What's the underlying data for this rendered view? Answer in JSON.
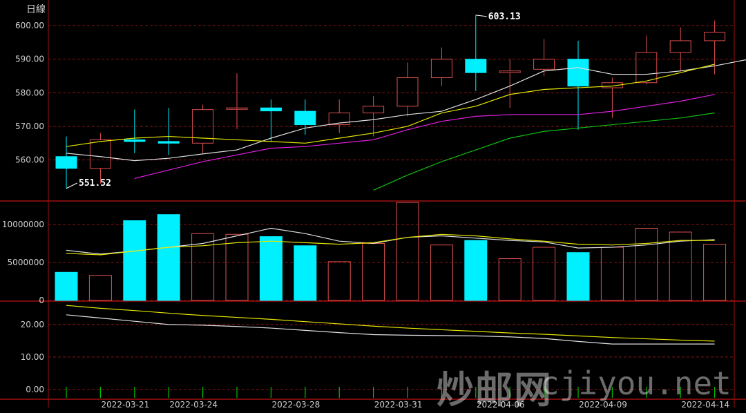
{
  "title": "日線",
  "watermark": {
    "chinese": "炒邮网",
    "latin": "cjiyou.net"
  },
  "colors": {
    "background": "#000000",
    "frame": "#a01010",
    "grid": "#8a1414",
    "up": "#e05050",
    "down": "#00f0ff",
    "text": "#d0d0d0",
    "ma_white": "#e0e0e0",
    "ma_yellow": "#e6e600",
    "ma_magenta": "#e020e0",
    "ma_green": "#10c010",
    "tick_green": "#00c000"
  },
  "chart_data": [
    {
      "type": "candlestick",
      "y_ticks": [
        "560.00",
        "570.00",
        "580.00",
        "590.00",
        "600.00"
      ],
      "ylim": [
        548,
        607
      ],
      "x_dates": [
        "2022-03-21",
        "2022-03-24",
        "2022-03-28",
        "2022-03-31",
        "2022-04-06",
        "2022-04-09",
        "2022-04-14"
      ],
      "x_date_index": [
        1,
        3,
        6,
        9,
        12,
        15,
        18
      ],
      "high_annotation": {
        "label": "603.13",
        "index": 12,
        "value": 603.13
      },
      "low_annotation": {
        "label": "551.52",
        "index": 0,
        "value": 551.52
      },
      "ohlc": [
        {
          "o": 561.0,
          "h": 567.0,
          "l": 551.52,
          "c": 557.5
        },
        {
          "o": 557.5,
          "h": 568.0,
          "l": 553.0,
          "c": 566.0
        },
        {
          "o": 566.0,
          "h": 575.0,
          "l": 562.0,
          "c": 565.5
        },
        {
          "o": 565.5,
          "h": 575.5,
          "l": 561.5,
          "c": 565.0
        },
        {
          "o": 565.0,
          "h": 576.5,
          "l": 562.0,
          "c": 575.0
        },
        {
          "o": 575.2,
          "h": 585.8,
          "l": 569.2,
          "c": 575.5
        },
        {
          "o": 575.5,
          "h": 578.0,
          "l": 565.5,
          "c": 574.6
        },
        {
          "o": 574.5,
          "h": 578.0,
          "l": 567.5,
          "c": 570.5
        },
        {
          "o": 570.5,
          "h": 578.0,
          "l": 568.0,
          "c": 574.0
        },
        {
          "o": 574.0,
          "h": 579.0,
          "l": 567.0,
          "c": 576.0
        },
        {
          "o": 576.0,
          "h": 589.0,
          "l": 573.0,
          "c": 584.5
        },
        {
          "o": 584.5,
          "h": 593.5,
          "l": 582.0,
          "c": 590.0
        },
        {
          "o": 590.0,
          "h": 603.13,
          "l": 580.5,
          "c": 586.0
        },
        {
          "o": 586.0,
          "h": 590.0,
          "l": 575.5,
          "c": 586.5
        },
        {
          "o": 587.0,
          "h": 596.0,
          "l": 585.0,
          "c": 590.0
        },
        {
          "o": 590.0,
          "h": 595.5,
          "l": 569.0,
          "c": 582.0
        },
        {
          "o": 581.5,
          "h": 584.5,
          "l": 572.5,
          "c": 583.0
        },
        {
          "o": 583.0,
          "h": 597.0,
          "l": 582.5,
          "c": 592.0
        },
        {
          "o": 592.0,
          "h": 599.5,
          "l": 586.5,
          "c": 595.5
        },
        {
          "o": 595.5,
          "h": 601.5,
          "l": 585.5,
          "c": 598.0
        }
      ],
      "ma": [
        {
          "color_key": "ma_white",
          "start": 0,
          "values": [
            562.0,
            561.0,
            559.8,
            560.5,
            561.8,
            563.0,
            566.5,
            569.5,
            571.0,
            572.0,
            573.5,
            574.5,
            578.0,
            582.0,
            586.5,
            587.5,
            585.5,
            585.5,
            586.5,
            588.0,
            590.0
          ]
        },
        {
          "color_key": "ma_yellow",
          "start": 0,
          "values": [
            564.0,
            565.5,
            566.5,
            567.0,
            566.5,
            566.0,
            565.5,
            565.0,
            566.5,
            568.0,
            570.0,
            574.0,
            576.0,
            579.5,
            581.0,
            581.5,
            582.0,
            583.5,
            586.0,
            588.5
          ]
        },
        {
          "color_key": "ma_magenta",
          "start": 2,
          "values": [
            554.5,
            557.0,
            559.5,
            561.5,
            563.5,
            564.0,
            565.0,
            566.0,
            569.0,
            571.5,
            573.0,
            573.5,
            573.5,
            573.5,
            574.5,
            576.0,
            577.5,
            579.5
          ]
        },
        {
          "color_key": "ma_green",
          "start": 9,
          "values": [
            551.0,
            555.5,
            559.5,
            563.0,
            566.5,
            568.5,
            569.5,
            570.5,
            571.5,
            572.5,
            574.0
          ]
        }
      ]
    },
    {
      "type": "bar",
      "y_ticks": [
        "0",
        "5000000",
        "10000000"
      ],
      "ylim": [
        0,
        13000000
      ],
      "values": [
        3700000,
        3300000,
        10500000,
        11300000,
        8800000,
        8700000,
        8400000,
        7200000,
        5100000,
        7500000,
        12900000,
        7300000,
        7900000,
        5500000,
        7000000,
        6300000,
        7000000,
        9500000,
        9000000,
        7400000
      ],
      "up": [
        false,
        true,
        false,
        false,
        true,
        true,
        false,
        false,
        true,
        true,
        true,
        true,
        false,
        true,
        true,
        false,
        true,
        true,
        true,
        true
      ],
      "ma": [
        {
          "color_key": "ma_white",
          "values": [
            6600000,
            6100000,
            6500000,
            7000000,
            7500000,
            8500000,
            9500000,
            8800000,
            7800000,
            7500000,
            8300000,
            8500000,
            8200000,
            7900000,
            7700000,
            6900000,
            7000000,
            7300000,
            7800000,
            8000000
          ]
        },
        {
          "color_key": "ma_yellow",
          "values": [
            6200000,
            6000000,
            6500000,
            7000000,
            7200000,
            7600000,
            7800000,
            7600000,
            7400000,
            7600000,
            8300000,
            8700000,
            8500000,
            8100000,
            7800000,
            7400000,
            7300000,
            7500000,
            7900000,
            7900000
          ]
        }
      ]
    },
    {
      "type": "line",
      "y_ticks": [
        "0.00",
        "10.00",
        "20.00"
      ],
      "ylim": [
        -3,
        27
      ],
      "series": [
        {
          "color_key": "ma_yellow",
          "values": [
            25.9,
            25.0,
            24.3,
            23.5,
            22.8,
            22.2,
            21.6,
            20.9,
            20.2,
            19.5,
            18.9,
            18.4,
            17.9,
            17.4,
            17.0,
            16.5,
            16.0,
            15.6,
            15.2,
            14.9
          ]
        },
        {
          "color_key": "ma_white",
          "values": [
            23.0,
            22.0,
            21.0,
            20.0,
            19.8,
            19.4,
            18.9,
            18.2,
            17.5,
            16.9,
            16.7,
            16.6,
            16.5,
            16.2,
            15.7,
            14.8,
            14.0,
            14.0,
            14.0,
            14.0
          ]
        }
      ]
    }
  ]
}
